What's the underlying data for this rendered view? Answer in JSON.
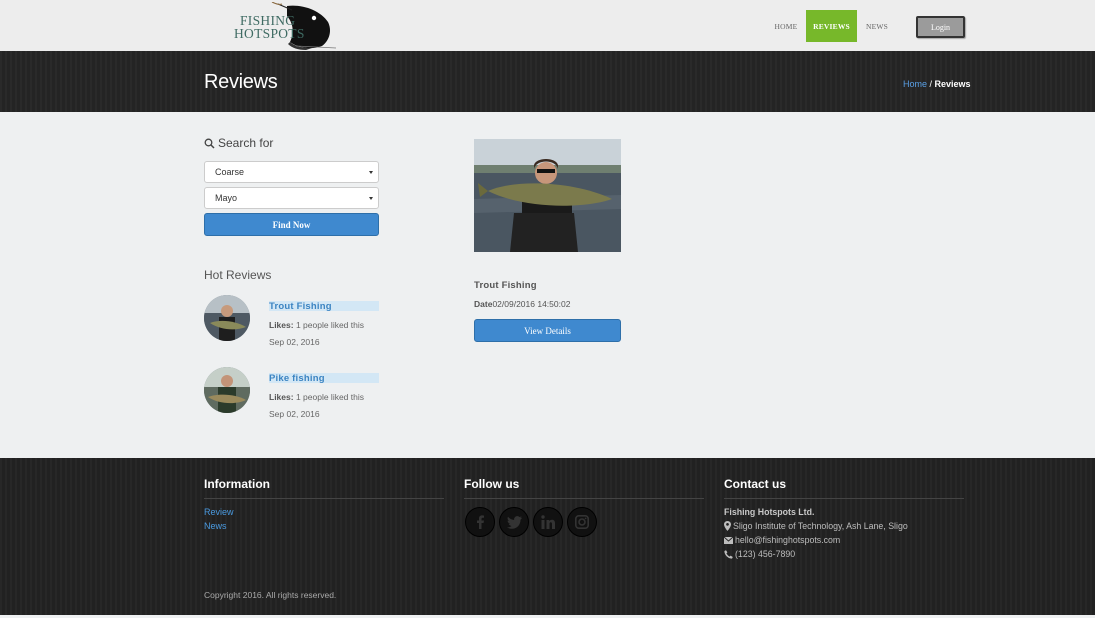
{
  "header": {
    "logo_line1": "FISHING",
    "logo_line2": "HOTSPOTS",
    "nav": [
      {
        "label": "HOME"
      },
      {
        "label": "REVIEWS"
      },
      {
        "label": "NEWS"
      }
    ],
    "login_label": "Login"
  },
  "titlebar": {
    "title": "Reviews",
    "breadcrumb_home": "Home",
    "breadcrumb_sep": " / ",
    "breadcrumb_current": "Reviews"
  },
  "sidebar": {
    "search_heading": "Search for",
    "select_type": "Coarse",
    "select_county": "Mayo",
    "find_button": "Find Now",
    "hot_heading": "Hot Reviews",
    "hot_reviews": [
      {
        "title": "Trout Fishing",
        "likes_label": "Likes:",
        "likes_text": "1 people liked this",
        "date": "Sep 02, 2016"
      },
      {
        "title": "Pike fishing",
        "likes_label": "Likes:",
        "likes_text": "1 people liked this",
        "date": "Sep 02, 2016"
      }
    ]
  },
  "main": {
    "card": {
      "title": "Trout Fishing",
      "date_label": "Date",
      "date_value": "02/09/2016 14:50:02",
      "button": "View Details"
    }
  },
  "footer": {
    "info_heading": "Information",
    "links": [
      "Review",
      "News"
    ],
    "follow_heading": "Follow us",
    "social_icons": [
      "facebook-icon",
      "twitter-icon",
      "linkedin-icon",
      "instagram-icon"
    ],
    "contact_heading": "Contact us",
    "company": "Fishing Hotspots Ltd.",
    "address": "Sligo Institute of Technology, Ash Lane, Sligo",
    "email": "hello@fishinghotspots.com",
    "phone": "(123) 456-7890",
    "copyright": "Copyright 2016. All rights reserved."
  },
  "colors": {
    "accent_green": "#77b82a",
    "button_blue": "#3f89cf",
    "link_blue": "#4a9ae0",
    "dark_band": "#262626"
  }
}
